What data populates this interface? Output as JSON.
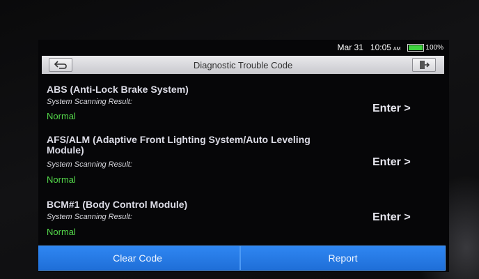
{
  "status": {
    "date": "Mar 31",
    "time": "10:05",
    "ampm": "AM",
    "battery": "100%"
  },
  "header": {
    "title": "Diagnostic Trouble Code"
  },
  "systems": [
    {
      "name": "ABS (Anti-Lock Brake System)",
      "result_label": "System Scanning Result:",
      "result": "Normal",
      "action": "Enter >"
    },
    {
      "name": "AFS/ALM (Adaptive Front Lighting System/Auto Leveling Module)",
      "result_label": "System Scanning Result:",
      "result": "Normal",
      "action": "Enter >"
    },
    {
      "name": "BCM#1 (Body Control Module)",
      "result_label": "System Scanning Result:",
      "result": "Normal",
      "action": "Enter >"
    }
  ],
  "footer": {
    "clear_label": "Clear Code",
    "report_label": "Report"
  },
  "colors": {
    "accent": "#2f86f2",
    "status_ok": "#54d84a",
    "battery": "#3fd33f"
  }
}
